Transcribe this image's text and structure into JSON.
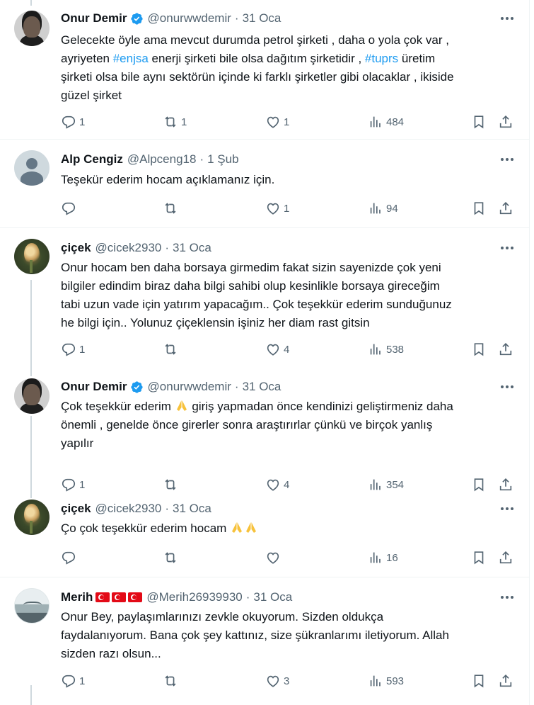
{
  "tweets": [
    {
      "name": "Onur Demir",
      "handle": "@onurwwdemir",
      "date": "31 Oca",
      "verified": true,
      "avatar": "onur-avatar",
      "lines": [
        "Gelecekte öyle ama mevcut durumda petrol şirketi , daha o yola çok var ,",
        "ayriyeten #enjsa enerji şirketi bile olsa dağıtım şirketidir , #tuprs üretim",
        "şirketi olsa bile aynı sektörün içinde ki farklı şirketler gibi olacaklar , ikiside",
        "güzel şirket"
      ],
      "replies": "1",
      "retweets": "1",
      "likes": "1",
      "views": "484"
    },
    {
      "name": "Alp Cengiz",
      "handle": "@Alpceng18",
      "date": "1 Şub",
      "verified": false,
      "avatar": "default-avatar",
      "lines": [
        "Teşekür ederim hocam açıklamanız için."
      ],
      "replies": "",
      "retweets": "",
      "likes": "1",
      "views": "94"
    },
    {
      "name": "çiçek",
      "handle": "@cicek2930",
      "date": "31 Oca",
      "verified": false,
      "avatar": "cicek-avatar",
      "lines": [
        "Onur hocam ben daha borsaya girmedim fakat sizin sayenizde çok yeni",
        "bilgiler edindim biraz daha bilgi sahibi olup kesinlikle borsaya gireceğim",
        "tabi uzun vade için yatırım yapacağım.. Çok teşekkür ederim sunduğunuz",
        "he bilgi için.. Yolunuz çiçeklensin işiniz her diam rast gitsin"
      ],
      "replies": "1",
      "retweets": "",
      "likes": "4",
      "views": "538"
    },
    {
      "name": "Onur Demir",
      "handle": "@onurwwdemir",
      "date": "31 Oca",
      "verified": true,
      "avatar": "onur-avatar",
      "lines": [
        "Çok teşekkür ederim",
        "önemli , genelde önce girerler sonra araştırırlar çünkü ve birçok yanlış",
        "yapılır"
      ],
      "line1_after_emoji": "giriş yapmadan önce kendinizi geliştirmeniz daha",
      "replies": "1",
      "retweets": "",
      "likes": "4",
      "views": "354"
    },
    {
      "name": "çiçek",
      "handle": "@cicek2930",
      "date": "31 Oca",
      "verified": false,
      "avatar": "cicek-avatar",
      "lines": [
        "Ço çok teşekkür ederim hocam"
      ],
      "replies": "",
      "retweets": "",
      "likes": "",
      "views": "16"
    },
    {
      "name": "Merih",
      "handle": "@Merih26939930",
      "date": "31 Oca",
      "verified": false,
      "avatar": "merih-avatar",
      "lines": [
        "Onur Bey, paylaşımlarınızı zevkle okuyorum. Sizden oldukça",
        "faydalanıyorum. Bana çok şey kattınız, size şükranlarımı iletiyorum. Allah",
        "sizden razı olsun..."
      ],
      "replies": "1",
      "retweets": "",
      "likes": "3",
      "views": "593"
    }
  ],
  "hashtags": [
    "#enjsa",
    "#tuprs"
  ],
  "colors": {
    "accent": "#1d9bf0",
    "muted": "#536471",
    "text": "#0f1419",
    "border": "#eff3f4"
  }
}
